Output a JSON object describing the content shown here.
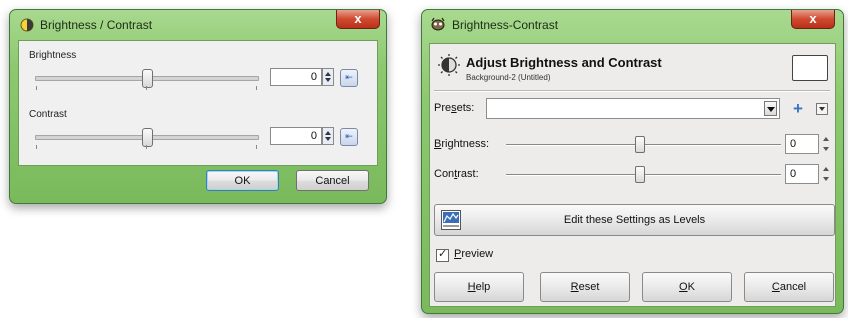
{
  "left_dialog": {
    "title": "Brightness / Contrast",
    "close_label": "x",
    "brightness_label": "Brightness",
    "brightness_value": "0",
    "contrast_label": "Contrast",
    "contrast_value": "0",
    "ok_label": "OK",
    "cancel_label": "Cancel",
    "slider_positions": {
      "brightness": 0.5,
      "contrast": 0.5
    },
    "icons": {
      "title": "brightness-contrast-icon",
      "reset": "reset-icon"
    }
  },
  "right_dialog": {
    "title": "Brightness-Contrast",
    "close_label": "x",
    "header_title": "Adjust Brightness and Contrast",
    "header_subtitle": "Background-2 (Untitled)",
    "presets_label_pre": "Pre",
    "presets_label_u": "s",
    "presets_label_post": "ets:",
    "presets_value": "",
    "brightness_label_u": "B",
    "brightness_label_post": "rightness:",
    "brightness_value": "0",
    "contrast_label_pre": "Con",
    "contrast_label_u": "t",
    "contrast_label_post": "rast:",
    "contrast_value": "0",
    "edit_levels_label": "Edit these Settings as Levels",
    "preview_label_u": "P",
    "preview_label_post": "review",
    "preview_checked": true,
    "buttons": {
      "help_u": "H",
      "help_post": "elp",
      "reset_u": "R",
      "reset_post": "eset",
      "ok_u": "O",
      "ok_post": "K",
      "cancel_u": "C",
      "cancel_post": "ancel"
    },
    "slider_positions": {
      "brightness": 0.5,
      "contrast": 0.5
    },
    "icons": {
      "title": "gimp-icon",
      "header": "brightness-contrast-icon",
      "add": "plus-icon",
      "menu": "menu-arrow-icon",
      "levels": "levels-icon"
    }
  }
}
